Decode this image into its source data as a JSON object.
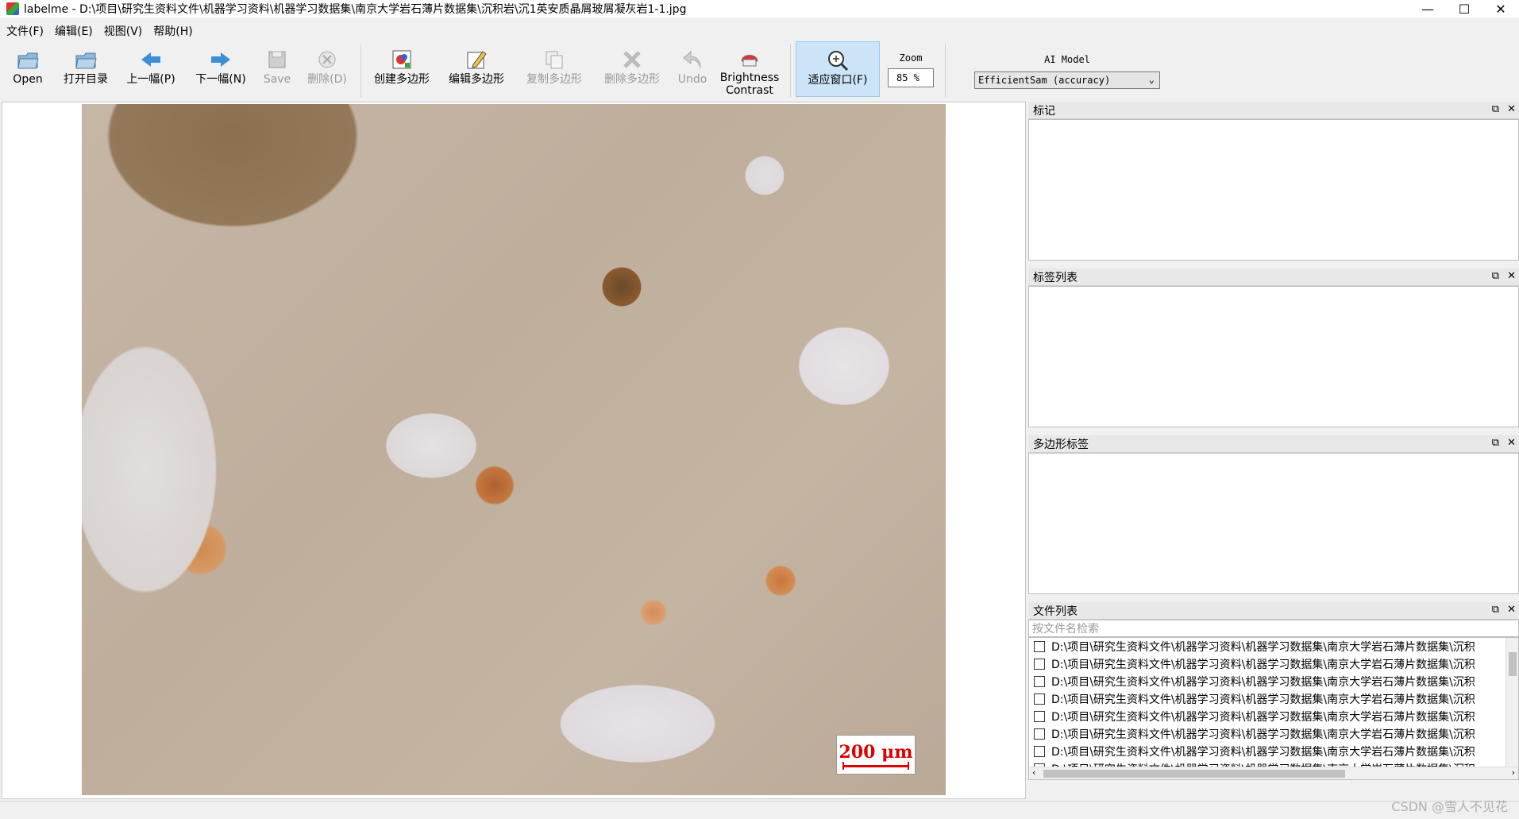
{
  "window": {
    "title": "labelme - D:\\项目\\研究生资料文件\\机器学习资料\\机器学习数据集\\南京大学岩石薄片数据集\\沉积岩\\沉1英安质晶屑玻屑凝灰岩1-1.jpg",
    "controls": [
      "—",
      "☐",
      "✕"
    ]
  },
  "menu": [
    "文件(F)",
    "编辑(E)",
    "视图(V)",
    "帮助(H)"
  ],
  "toolbar": {
    "open": "Open",
    "open_dir": "打开目录",
    "prev": "上一幅(P)",
    "next": "下一幅(N)",
    "save": "Save",
    "delete": "删除(D)",
    "create_polygon": "创建多边形",
    "edit_polygon": "编辑多边形",
    "copy_polygon": "复制多边形",
    "delete_polygon": "删除多边形",
    "undo": "Undo",
    "brightness": "Brightness\nContrast",
    "brightness_l1": "Brightness",
    "brightness_l2": "Contrast",
    "fit_window": "适应窗口(F)",
    "zoom_label": "Zoom",
    "zoom_value": "85 %",
    "ai_label": "AI Model",
    "ai_value": "EfficientSam (accuracy)"
  },
  "canvas": {
    "scalebar": "200 μm"
  },
  "docks": {
    "flags": "标记",
    "label_list": "标签列表",
    "polygon_labels": "多边形标签",
    "file_list": "文件列表",
    "file_search_placeholder": "按文件名检索",
    "restore_icon": "⧉",
    "close_icon": "✕"
  },
  "files": [
    "D:\\项目\\研究生资料文件\\机器学习资料\\机器学习数据集\\南京大学岩石薄片数据集\\沉积",
    "D:\\项目\\研究生资料文件\\机器学习资料\\机器学习数据集\\南京大学岩石薄片数据集\\沉积",
    "D:\\项目\\研究生资料文件\\机器学习资料\\机器学习数据集\\南京大学岩石薄片数据集\\沉积",
    "D:\\项目\\研究生资料文件\\机器学习资料\\机器学习数据集\\南京大学岩石薄片数据集\\沉积",
    "D:\\项目\\研究生资料文件\\机器学习资料\\机器学习数据集\\南京大学岩石薄片数据集\\沉积",
    "D:\\项目\\研究生资料文件\\机器学习资料\\机器学习数据集\\南京大学岩石薄片数据集\\沉积",
    "D:\\项目\\研究生资料文件\\机器学习资料\\机器学习数据集\\南京大学岩石薄片数据集\\沉积",
    "D:\\项目\\研究生资料文件\\机器学习资料\\机器学习数据集\\南京大学岩石薄片数据集\\沉积"
  ],
  "watermark": "CSDN @雪人不见花",
  "colors": {
    "active_tool": "#cce4f7",
    "accent_blue": "#3c8fd6",
    "scalebar_red": "#dd0000"
  }
}
